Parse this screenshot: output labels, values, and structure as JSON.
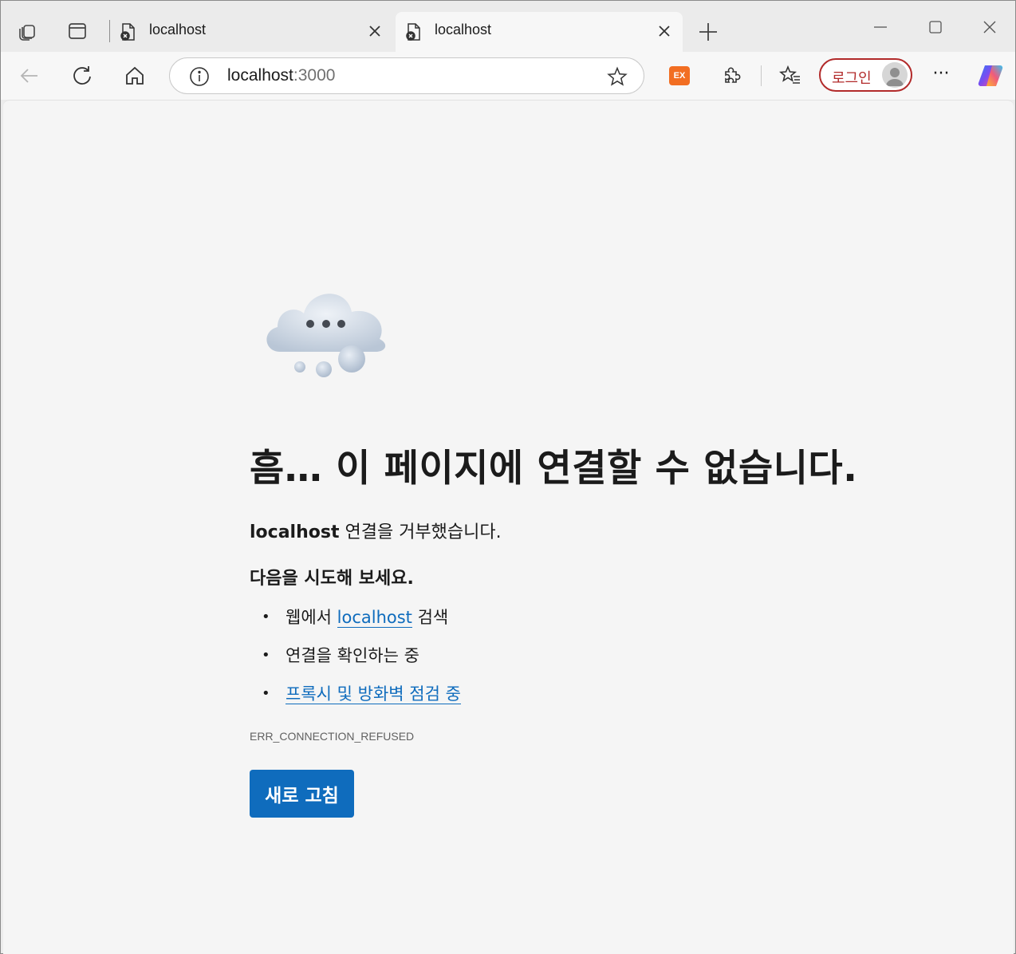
{
  "tabs": [
    {
      "title": "localhost",
      "state": "inactive",
      "favicon": "error-page-icon"
    },
    {
      "title": "localhost",
      "state": "active",
      "favicon": "error-page-icon"
    }
  ],
  "omnibox": {
    "host": "localhost",
    "port": ":3000"
  },
  "extensions": {
    "ex_label": "EX"
  },
  "profile": {
    "login_label": "로그인"
  },
  "colors": {
    "accent": "#0f6cbd",
    "login_border": "#b22a2a",
    "ex_badge": "#f26e22"
  },
  "error": {
    "headline": "흠… 이 페이지에 연결할 수 없습니다.",
    "host": "localhost",
    "reason": " 연결을 거부했습니다.",
    "try_title": "다음을 시도해 보세요.",
    "suggestions": {
      "s1_prefix": "웹에서 ",
      "s1_link": "localhost",
      "s1_suffix": " 검색",
      "s2": "연결을 확인하는 중",
      "s3_link": "프록시 및 방화벽 점검 중"
    },
    "code": "ERR_CONNECTION_REFUSED",
    "refresh_label": "새로 고침"
  }
}
